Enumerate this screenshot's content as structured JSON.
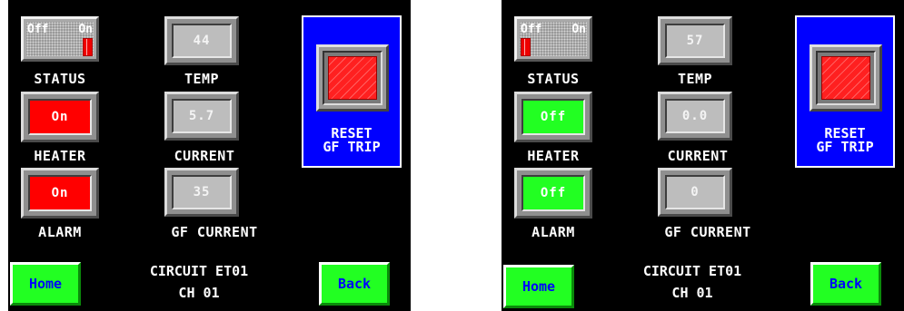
{
  "colors": {
    "background": "#000000",
    "value_box": "#bdbdbd",
    "active_red": "#ff0000",
    "inactive_green": "#22ff22",
    "reset_panel": "#0000ff",
    "nav_text": "#0000ff"
  },
  "panels": [
    {
      "status": {
        "off_label": "Off",
        "on_label": "On",
        "state": "On",
        "label": "STATUS"
      },
      "temp": {
        "value": "44",
        "label": "TEMP"
      },
      "heater": {
        "value": "On",
        "label": "HEATER",
        "color": "red"
      },
      "current": {
        "value": "5.7",
        "label": "CURRENT"
      },
      "alarm": {
        "value": "On",
        "label": "ALARM",
        "color": "red"
      },
      "gf_current": {
        "value": "35",
        "label": "GF CURRENT"
      },
      "reset": {
        "line1": "RESET",
        "line2": "GF TRIP"
      },
      "footer": {
        "circuit": "CIRCUIT ET01",
        "channel": "CH 01"
      },
      "nav": {
        "home": "Home",
        "back": "Back"
      }
    },
    {
      "status": {
        "off_label": "Off",
        "on_label": "On",
        "state": "Off",
        "label": "STATUS"
      },
      "temp": {
        "value": "57",
        "label": "TEMP"
      },
      "heater": {
        "value": "Off",
        "label": "HEATER",
        "color": "green"
      },
      "current": {
        "value": "0.0",
        "label": "CURRENT"
      },
      "alarm": {
        "value": "Off",
        "label": "ALARM",
        "color": "green"
      },
      "gf_current": {
        "value": "0",
        "label": "GF CURRENT"
      },
      "reset": {
        "line1": "RESET",
        "line2": "GF TRIP"
      },
      "footer": {
        "circuit": "CIRCUIT ET01",
        "channel": "CH 01"
      },
      "nav": {
        "home": "Home",
        "back": "Back"
      }
    }
  ]
}
